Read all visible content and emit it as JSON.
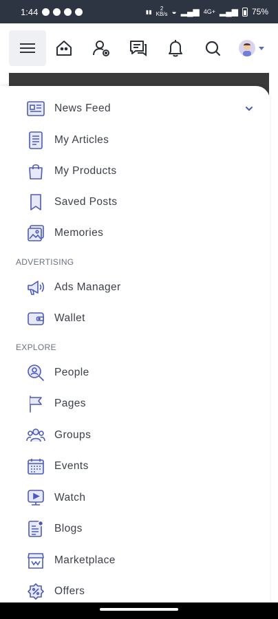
{
  "status": {
    "time": "1:44",
    "net_top": "2",
    "net_bottom": "KB/s",
    "signal_label": "4G+",
    "battery": "75%"
  },
  "header": {
    "menu_icon": "hamburger-icon",
    "icons": [
      "home-icon",
      "add-friend-icon",
      "messages-icon",
      "notifications-icon",
      "search-icon"
    ],
    "avatar_icon": "avatar-icon"
  },
  "menu": {
    "primary": [
      {
        "label": "News Feed",
        "icon": "news-feed-icon"
      },
      {
        "label": "My Articles",
        "icon": "articles-icon"
      },
      {
        "label": "My Products",
        "icon": "products-icon"
      },
      {
        "label": "Saved Posts",
        "icon": "bookmark-icon"
      },
      {
        "label": "Memories",
        "icon": "memories-icon"
      }
    ],
    "advertising_title": "ADVERTISING",
    "advertising": [
      {
        "label": "Ads Manager",
        "icon": "megaphone-icon"
      },
      {
        "label": "Wallet",
        "icon": "wallet-icon"
      }
    ],
    "explore_title": "EXPLORE",
    "explore": [
      {
        "label": "People",
        "icon": "people-icon"
      },
      {
        "label": "Pages",
        "icon": "flag-icon"
      },
      {
        "label": "Groups",
        "icon": "groups-icon"
      },
      {
        "label": "Events",
        "icon": "calendar-icon"
      },
      {
        "label": "Watch",
        "icon": "watch-icon"
      },
      {
        "label": "Blogs",
        "icon": "blogs-icon"
      },
      {
        "label": "Marketplace",
        "icon": "marketplace-icon"
      },
      {
        "label": "Offers",
        "icon": "offers-icon"
      }
    ]
  },
  "colors": {
    "accent": "#4a5ac0",
    "icon_fill": "#e7e9f7",
    "text": "#3b3f4a"
  }
}
